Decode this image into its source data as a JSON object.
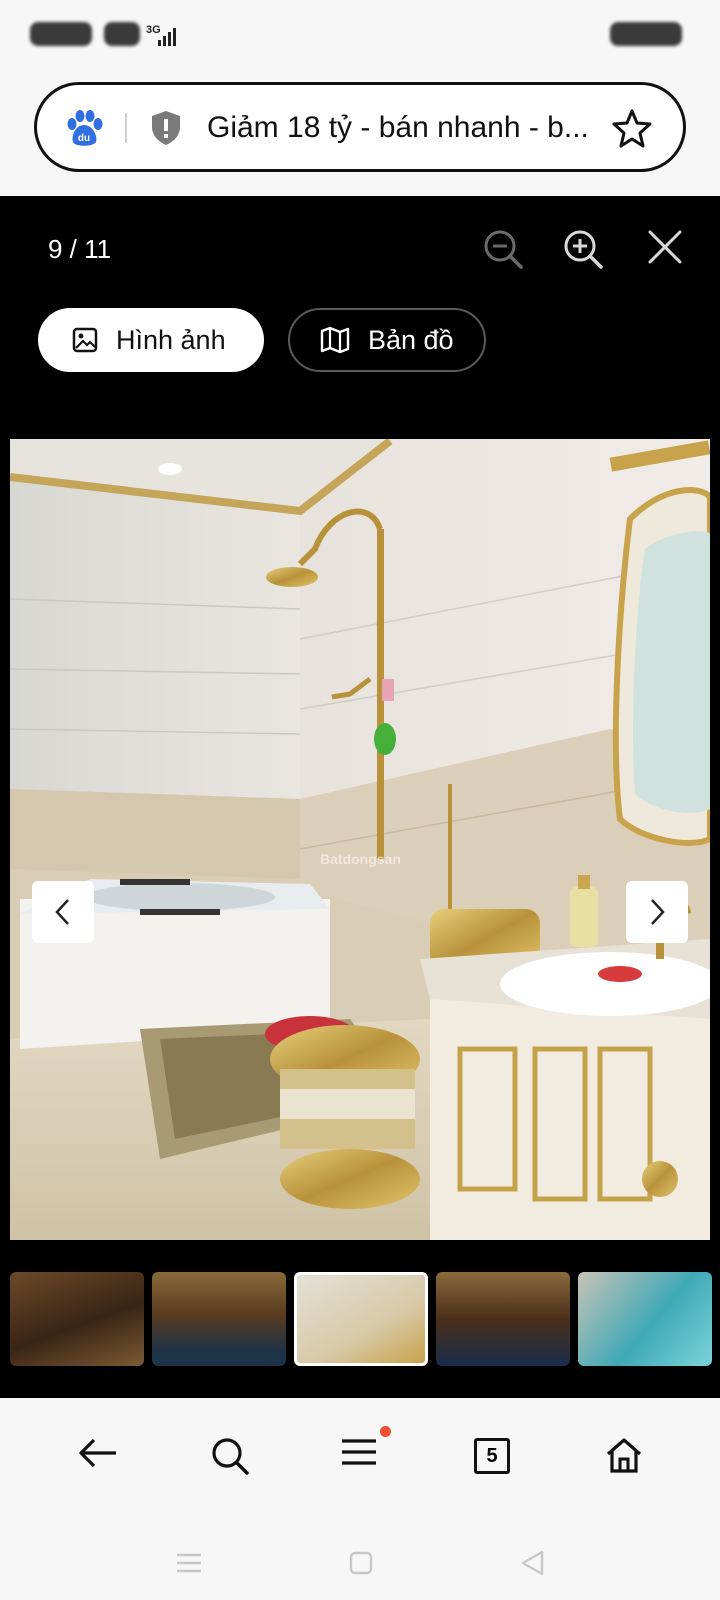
{
  "status_bar": {
    "signal_label": "3G"
  },
  "browser": {
    "page_title": "Giảm 18 tỷ - bán nhanh - b..."
  },
  "viewer": {
    "counter": "9 / 11",
    "tabs": [
      {
        "label": "Hình ảnh",
        "icon": "image-icon",
        "selected": true
      },
      {
        "label": "Bản đồ",
        "icon": "map-icon",
        "selected": false
      }
    ],
    "watermark": "Batdongsan",
    "thumbnails": [
      {
        "index": 8,
        "selected": false
      },
      {
        "index": 9,
        "selected": false
      },
      {
        "index": 10,
        "selected": true
      },
      {
        "index": 11,
        "selected": false
      },
      {
        "index": 12,
        "selected": false
      }
    ]
  },
  "bottom_nav": {
    "items": [
      "back-icon",
      "search-icon",
      "menu-icon",
      "tabs-icon",
      "home-icon"
    ],
    "tabs_count": "5"
  },
  "colors": {
    "notification_dot": "#f04e2e",
    "viewer_bg": "#000000"
  }
}
